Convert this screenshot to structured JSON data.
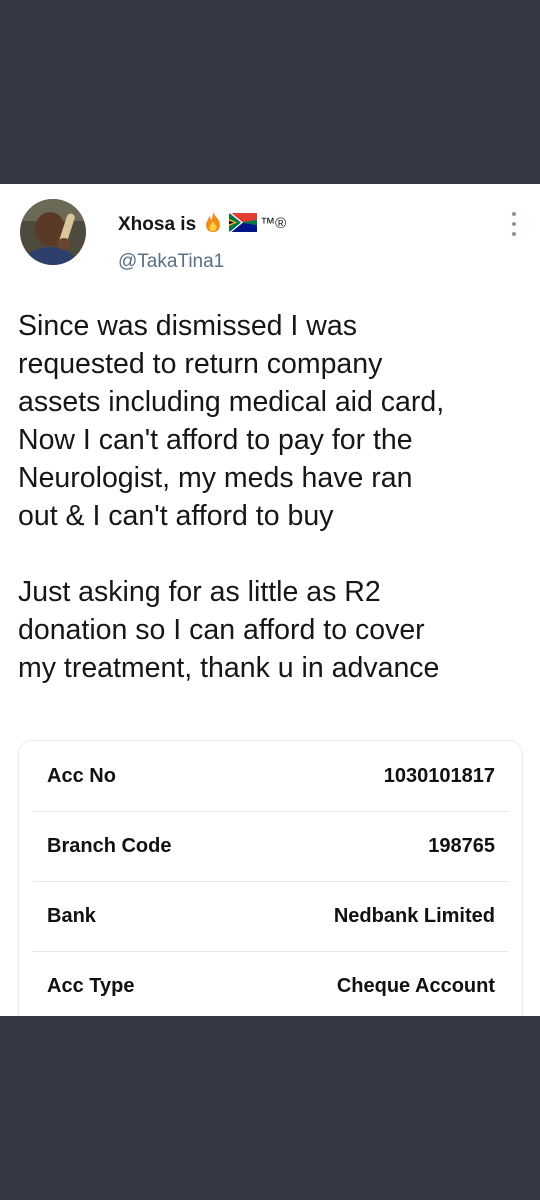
{
  "tweet": {
    "display_name": "Xhosa is",
    "name_badges": [
      "fire-emoji",
      "south-africa-flag"
    ],
    "trademark": "™®",
    "handle": "@TakaTina1",
    "paragraphs": [
      [
        "Since was dismissed I was",
        "requested to return company",
        "assets including medical aid card,",
        "Now I can't afford to pay for the",
        "Neurologist, my meds have ran",
        "out & I can't afford to buy"
      ],
      [
        "Just asking for as little as R2",
        "donation so I can afford to cover",
        "my treatment, thank u in advance"
      ]
    ]
  },
  "bank_details": [
    {
      "label": "Acc No",
      "value": "1030101817"
    },
    {
      "label": "Branch Code",
      "value": "198765"
    },
    {
      "label": "Bank",
      "value": "Nedbank Limited"
    },
    {
      "label": "Acc Type",
      "value": "Cheque Account"
    }
  ],
  "colors": {
    "background": "#333842",
    "card": "#ffffff",
    "text": "#14171a",
    "handle": "#5b7083"
  }
}
